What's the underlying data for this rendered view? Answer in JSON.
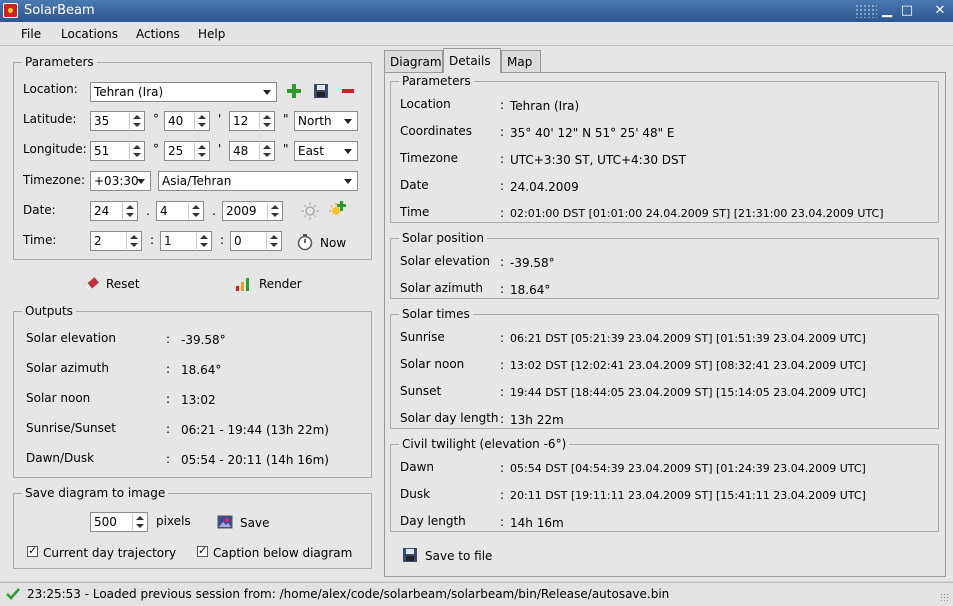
{
  "window": {
    "title": "SolarBeam"
  },
  "menu": [
    "File",
    "Locations",
    "Actions",
    "Help"
  ],
  "params": {
    "title": "Parameters",
    "location_label": "Location:",
    "location_value": "Tehran (Ira)",
    "latitude_label": "Latitude:",
    "lat_deg": "35",
    "lat_min": "40",
    "lat_sec": "12",
    "lat_dir": "North",
    "longitude_label": "Longitude:",
    "lon_deg": "51",
    "lon_min": "25",
    "lon_sec": "48",
    "lon_dir": "East",
    "timezone_label": "Timezone:",
    "tz_offset": "+03:30",
    "tz_name": "Asia/Tehran",
    "date_label": "Date:",
    "date_day": "24",
    "date_month": "4",
    "date_year": "2009",
    "time_label": "Time:",
    "time_h": "2",
    "time_m": "1",
    "time_s": "0",
    "now_label": "Now",
    "deg_sym": "°",
    "min_sym": "'",
    "sec_sym": "\"",
    "date_sep": ".",
    "time_sep": ":"
  },
  "actions": {
    "reset": "Reset",
    "render": "Render"
  },
  "outputs": {
    "title": "Outputs",
    "rows": [
      {
        "label": "Solar elevation",
        "value": "-39.58°"
      },
      {
        "label": "Solar azimuth",
        "value": "18.64°"
      },
      {
        "label": "Solar noon",
        "value": "13:02"
      },
      {
        "label": "Sunrise/Sunset",
        "value": "06:21 - 19:44  (13h 22m)"
      },
      {
        "label": "Dawn/Dusk",
        "value": "05:54 - 20:11  (14h 16m)"
      }
    ]
  },
  "save_diagram": {
    "title": "Save diagram to image",
    "size_value": "500",
    "pixels_label": "pixels",
    "save_label": "Save",
    "cb_trajectory": "Current day trajectory",
    "cb_caption": "Caption below diagram"
  },
  "tabs": [
    "Diagram",
    "Details",
    "Map"
  ],
  "details": {
    "parameters": {
      "title": "Parameters",
      "rows": [
        {
          "label": "Location",
          "value": "Tehran (Ira)"
        },
        {
          "label": "Coordinates",
          "value": "35° 40' 12\" N   51° 25' 48\" E"
        },
        {
          "label": "Timezone",
          "value": "UTC+3:30 ST, UTC+4:30 DST"
        },
        {
          "label": "Date",
          "value": "24.04.2009"
        },
        {
          "label": "Time",
          "value": "02:01:00 DST  [01:01:00 24.04.2009 ST]  [21:31:00 23.04.2009 UTC]"
        }
      ]
    },
    "solar_position": {
      "title": "Solar position",
      "rows": [
        {
          "label": "Solar elevation",
          "value": "-39.58°"
        },
        {
          "label": "Solar azimuth",
          "value": "18.64°"
        }
      ]
    },
    "solar_times": {
      "title": "Solar times",
      "rows": [
        {
          "label": "Sunrise",
          "value": "06:21 DST  [05:21:39 23.04.2009 ST]  [01:51:39 23.04.2009 UTC]"
        },
        {
          "label": "Solar noon",
          "value": "13:02 DST  [12:02:41 23.04.2009 ST]  [08:32:41 23.04.2009 UTC]"
        },
        {
          "label": "Sunset",
          "value": "19:44 DST  [18:44:05 23.04.2009 ST]  [15:14:05 23.04.2009 UTC]"
        },
        {
          "label": "Solar day length",
          "value": "13h 22m"
        }
      ]
    },
    "civil_twilight": {
      "title": "Civil twilight (elevation -6°)",
      "rows": [
        {
          "label": "Dawn",
          "value": "05:54 DST  [04:54:39 23.04.2009 ST]  [01:24:39 23.04.2009 UTC]"
        },
        {
          "label": "Dusk",
          "value": "20:11 DST  [19:11:11 23.04.2009 ST]  [15:41:11 23.04.2009 UTC]"
        },
        {
          "label": "Day length",
          "value": "14h 16m"
        }
      ]
    },
    "colon": ":",
    "save_to_file": "Save to file"
  },
  "status": {
    "text": "23:25:53 - Loaded previous session from: /home/alex/code/solarbeam/solarbeam/bin/Release/autosave.bin"
  },
  "colors": {
    "add": "#2e9b2e",
    "remove": "#d42020",
    "titlebar": "#2c5690"
  }
}
